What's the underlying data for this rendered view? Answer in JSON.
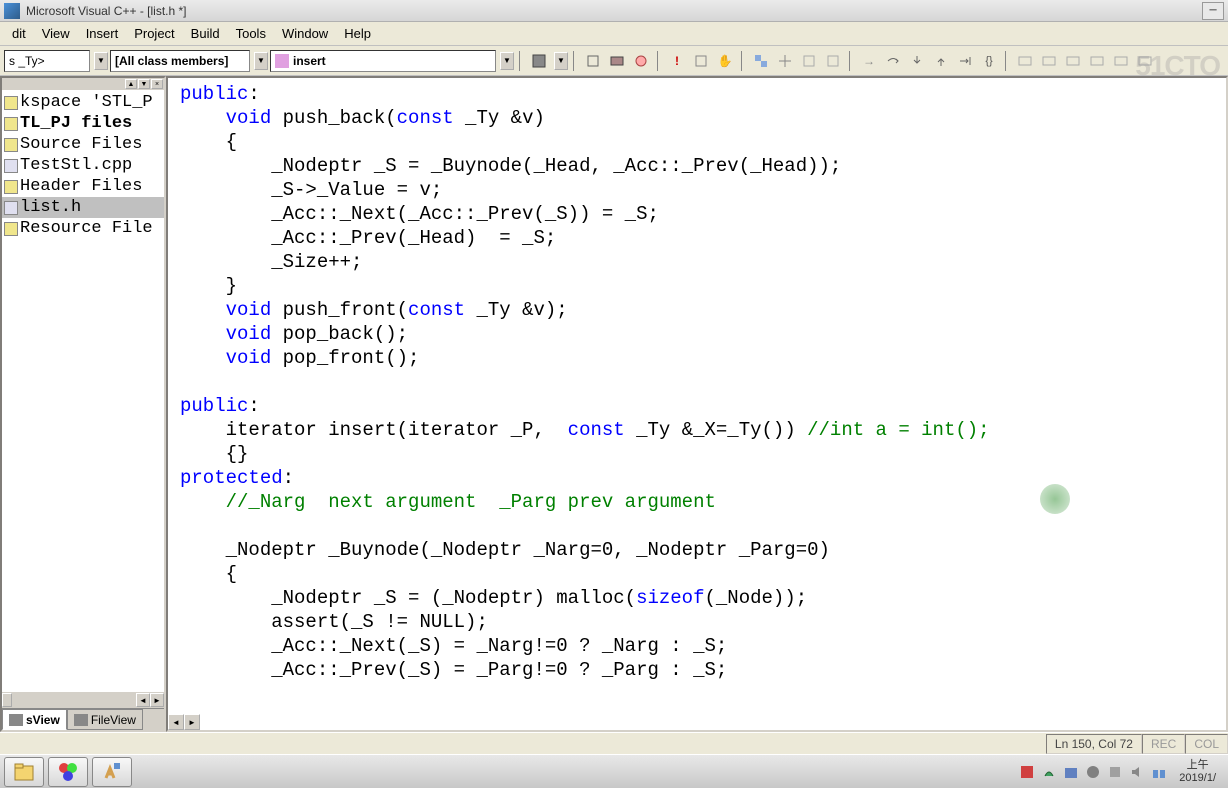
{
  "titlebar": {
    "text": "Microsoft Visual C++ - [list.h *]"
  },
  "menubar": {
    "items": [
      "dit",
      "View",
      "Insert",
      "Project",
      "Build",
      "Tools",
      "Window",
      "Help"
    ]
  },
  "watermark": "51CTO",
  "combos": {
    "class": "s _Ty>",
    "members": "[All class members]",
    "function": "insert"
  },
  "sidebar": {
    "items": [
      {
        "label": "kspace 'STL_P",
        "bold": false,
        "type": "folder"
      },
      {
        "label": "TL_PJ files",
        "bold": true,
        "type": "folder"
      },
      {
        "label": "Source Files",
        "bold": false,
        "type": "folder"
      },
      {
        "label": "TestStl.cpp",
        "bold": false,
        "type": "file"
      },
      {
        "label": "Header Files",
        "bold": false,
        "type": "folder"
      },
      {
        "label": "list.h",
        "bold": false,
        "type": "file",
        "selected": true
      },
      {
        "label": "Resource File",
        "bold": false,
        "type": "folder"
      }
    ],
    "tabs": [
      {
        "label": "sView",
        "active": true
      },
      {
        "label": "FileView",
        "active": false
      }
    ]
  },
  "code": {
    "lines": [
      {
        "t": "public",
        "c": "kw"
      },
      {
        "t": ":\n    ",
        "c": ""
      },
      {
        "t": "void",
        "c": "kw"
      },
      {
        "t": " push_back(",
        "c": ""
      },
      {
        "t": "const",
        "c": "kw"
      },
      {
        "t": " _Ty &v)\n    {\n        _Nodeptr _S = _Buynode(_Head, _Acc::_Prev(_Head));\n        _S->_Value = v;\n        _Acc::_Next(_Acc::_Prev(_S)) = _S;\n        _Acc::_Prev(_Head)  = _S;\n        _Size++;\n    }\n    ",
        "c": ""
      },
      {
        "t": "void",
        "c": "kw"
      },
      {
        "t": " push_front(",
        "c": ""
      },
      {
        "t": "const",
        "c": "kw"
      },
      {
        "t": " _Ty &v);\n    ",
        "c": ""
      },
      {
        "t": "void",
        "c": "kw"
      },
      {
        "t": " pop_back();\n    ",
        "c": ""
      },
      {
        "t": "void",
        "c": "kw"
      },
      {
        "t": " pop_front();\n\n",
        "c": ""
      },
      {
        "t": "public",
        "c": "kw"
      },
      {
        "t": ":\n    iterator insert(iterator _P,  ",
        "c": ""
      },
      {
        "t": "const",
        "c": "kw"
      },
      {
        "t": " _Ty &_X=_Ty()) ",
        "c": ""
      },
      {
        "t": "//int a = int();",
        "c": "cm"
      },
      {
        "t": "\n    {}\n",
        "c": ""
      },
      {
        "t": "protected",
        "c": "kw"
      },
      {
        "t": ":\n    ",
        "c": ""
      },
      {
        "t": "//_Narg  next argument  _Parg prev argument",
        "c": "cm"
      },
      {
        "t": "\n\n    _Nodeptr _Buynode(_Nodeptr _Narg=0, _Nodeptr _Parg=0)\n    {\n        _Nodeptr _S = (_Nodeptr) malloc(",
        "c": ""
      },
      {
        "t": "sizeof",
        "c": "kw"
      },
      {
        "t": "(_Node));\n        assert(_S != NULL);\n        _Acc::_Next(_S) = _Narg!=0 ? _Narg : _S;\n        _Acc::_Prev(_S) = _Parg!=0 ? _Parg : _S;",
        "c": ""
      }
    ]
  },
  "status": {
    "position": "Ln 150, Col 72",
    "rec": "REC",
    "col": "COL"
  },
  "tray": {
    "time_top": "上午",
    "time_bottom": "2019/1/"
  }
}
